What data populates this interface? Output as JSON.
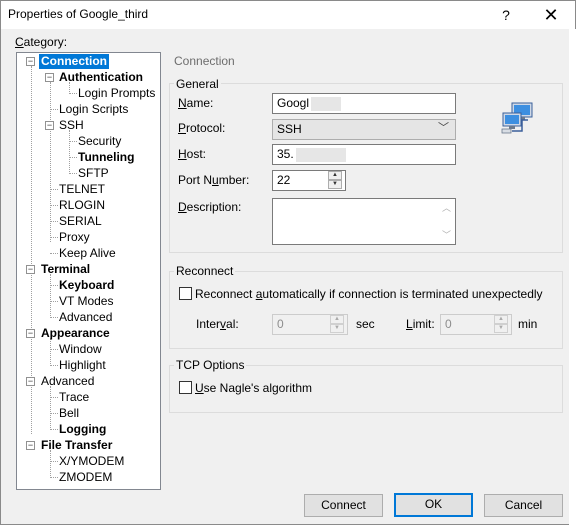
{
  "window": {
    "title": "Properties of Google_third",
    "help_glyph": "?",
    "close_glyph": "✕"
  },
  "category": {
    "label_mnemonic": "C",
    "label_rest": "ategory:"
  },
  "tree": {
    "items": [
      {
        "label": "Connection"
      },
      {
        "label": "Authentication"
      },
      {
        "label": "Login Prompts"
      },
      {
        "label": "Login Scripts"
      },
      {
        "label": "SSH"
      },
      {
        "label": "Security"
      },
      {
        "label": "Tunneling"
      },
      {
        "label": "SFTP"
      },
      {
        "label": "TELNET"
      },
      {
        "label": "RLOGIN"
      },
      {
        "label": "SERIAL"
      },
      {
        "label": "Proxy"
      },
      {
        "label": "Keep Alive"
      },
      {
        "label": "Terminal"
      },
      {
        "label": "Keyboard"
      },
      {
        "label": "VT Modes"
      },
      {
        "label": "Advanced"
      },
      {
        "label": "Appearance"
      },
      {
        "label": "Window"
      },
      {
        "label": "Highlight"
      },
      {
        "label": "Advanced"
      },
      {
        "label": "Trace"
      },
      {
        "label": "Bell"
      },
      {
        "label": "Logging"
      },
      {
        "label": "File Transfer"
      },
      {
        "label": "X/YMODEM"
      },
      {
        "label": "ZMODEM"
      }
    ],
    "expand_minus": "−"
  },
  "panel": {
    "heading": "Connection"
  },
  "general": {
    "title": "General",
    "name": {
      "mnemonic": "N",
      "rest": "ame:",
      "value": "Googl"
    },
    "protocol": {
      "mnemonic": "P",
      "rest": "rotocol:",
      "value": "SSH",
      "chevron": "﹀"
    },
    "host": {
      "mnemonic": "H",
      "rest": "ost:",
      "value": "35."
    },
    "port": {
      "pre": "Port N",
      "mnemonic": "u",
      "rest": "mber:",
      "value": "22"
    },
    "description": {
      "mnemonic": "D",
      "rest": "escription:",
      "value": ""
    },
    "spin_up": "▲",
    "spin_down": "▼",
    "scroll_up": "︿",
    "scroll_down": "﹀"
  },
  "reconnect": {
    "title": "Reconnect",
    "checkbox_pre": "Reconnect ",
    "checkbox_mnemonic": "a",
    "checkbox_rest": "utomatically if connection is terminated unexpectedly",
    "checked": false,
    "interval": {
      "pre": "Inter",
      "mnemonic": "v",
      "rest": "al:",
      "value": "0",
      "unit": "sec"
    },
    "limit": {
      "mnemonic": "L",
      "rest": "imit:",
      "value": "0",
      "unit": "min"
    }
  },
  "tcp": {
    "title": "TCP Options",
    "checkbox_mnemonic": "U",
    "checkbox_rest": "se Nagle's algorithm",
    "checked": false
  },
  "buttons": {
    "connect": "Connect",
    "ok": "OK",
    "cancel": "Cancel"
  },
  "colors": {
    "accent": "#0078d7",
    "dialog_bg": "#f0f0f0"
  },
  "icons": {
    "network": "network-computers-icon"
  }
}
